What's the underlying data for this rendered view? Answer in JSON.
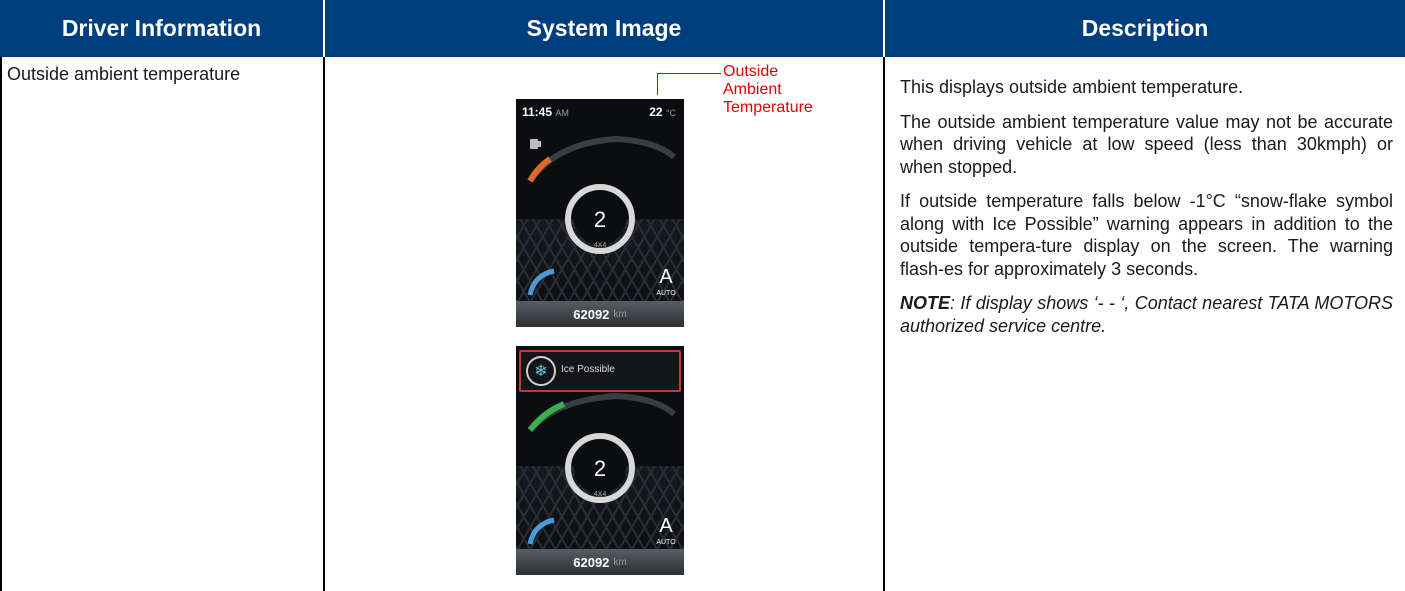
{
  "header": {
    "col1": "Driver Information",
    "col2": "System Image",
    "col3": "Description"
  },
  "row": {
    "driver_info": "Outside ambient temperature",
    "callout": [
      "Outside",
      "Ambient",
      "Temperature"
    ],
    "screen1": {
      "time": "11:45",
      "ampm": "AM",
      "temp": "22",
      "temp_unit": "°C",
      "gear": "2",
      "drive": "4X4",
      "mode": "A",
      "mode_label": "AUTO",
      "odometer": "62092",
      "odo_unit": "km"
    },
    "screen2": {
      "warning": "Ice Possible",
      "gear": "2",
      "drive": "4X4",
      "mode": "A",
      "mode_label": "AUTO",
      "odometer": "62092",
      "odo_unit": "km"
    },
    "description": [
      "This displays outside ambient temperature.",
      "The outside ambient temperature value may not be accurate when driving vehicle at low speed (less than 30kmph) or when stopped.",
      "If outside temperature falls below -1°C “snow-flake symbol along with Ice Possible” warning appears in addition to the outside tempera-ture display on the screen. The warning flash-es for approximately 3 seconds."
    ],
    "note_label": "NOTE",
    "note_text": ": If display shows ‘- - ‘, Contact nearest TATA MOTORS authorized service centre."
  },
  "colors": {
    "header_bg": "#003e7e",
    "header_text": "#ffffff",
    "callout": "#e00000",
    "fuel_arc": "#e0662a",
    "temp_arc": "#4a9bd8",
    "ice_arc": "#3cb050",
    "warning_border": "#c33a3a"
  }
}
